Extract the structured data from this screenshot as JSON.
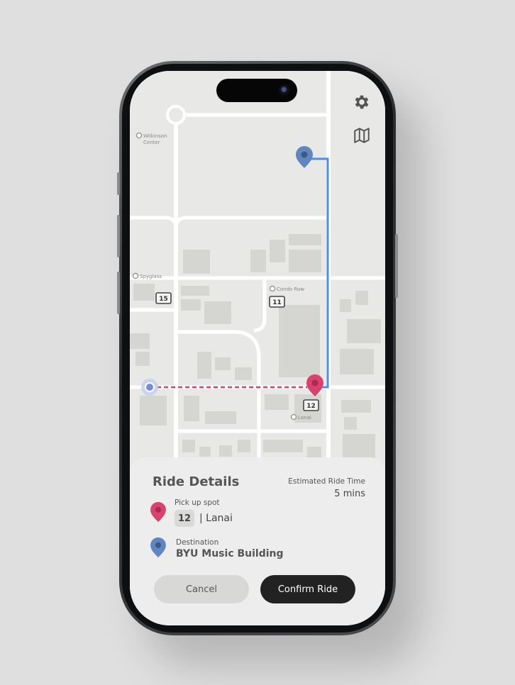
{
  "map": {
    "labels": {
      "wilkinson_line1": "Wilkinson",
      "wilkinson_line2": "Center",
      "spyglass": "Spyglass",
      "condo_row": "Condo Row",
      "lanai": "Lanai"
    },
    "stops": {
      "stop_15": "15",
      "stop_11": "11",
      "stop_12": "12"
    },
    "icons": {
      "settings": "gear-icon",
      "map_view": "map-icon"
    },
    "colors": {
      "pickup": "#d9416f",
      "destination": "#5f86c0",
      "route": "#4a8fe8",
      "walk_path": "#d9416f",
      "current_location": "#6f8fd8"
    }
  },
  "ride_details": {
    "title": "Ride Details",
    "eta_label": "Estimated Ride Time",
    "eta_value": "5 mins",
    "pickup_label": "Pick up spot",
    "pickup_stop": "12",
    "pickup_name": "| Lanai",
    "destination_label": "Destination",
    "destination_name": "BYU Music Building"
  },
  "actions": {
    "cancel_label": "Cancel",
    "confirm_label": "Confirm Ride"
  }
}
